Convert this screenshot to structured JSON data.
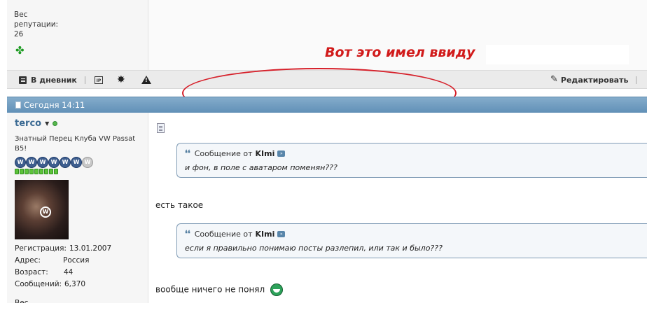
{
  "top_post": {
    "reputation_label_1": "Вес",
    "reputation_label_2": "репутации:",
    "reputation_value": "26"
  },
  "annotation": {
    "text": "Вот это имел ввиду",
    "color": "#d11a1a"
  },
  "toolbar": {
    "diary_label": "В дневник",
    "ip_label": "IP",
    "edit_label": "Редактировать"
  },
  "post": {
    "date": "Сегодня 14:11",
    "user": {
      "name": "terco",
      "title": "Знатный Перец Клуба VW Passat B5!",
      "reg_label": "Регистрация:",
      "reg_value": "13.01.2007",
      "addr_label": "Адрес:",
      "addr_value": "Россия",
      "age_label": "Возраст:",
      "age_value": "44",
      "posts_label": "Сообщений:",
      "posts_value": "6,370",
      "rep_label": "Вес"
    },
    "quotes": [
      {
        "prefix": "Сообщение от",
        "author": "KImi",
        "text": "и фон, в поле с аватаром поменян???"
      },
      {
        "prefix": "Сообщение от",
        "author": "KImi",
        "text": "если я правильно понимаю посты разлепил, или так и было???"
      }
    ],
    "messages": [
      "есть такое",
      "вообще ничего не понял"
    ]
  },
  "colors": {
    "header_bar": "#6f9bbf",
    "username": "#3b6a93",
    "ellipse": "#d6202a"
  }
}
